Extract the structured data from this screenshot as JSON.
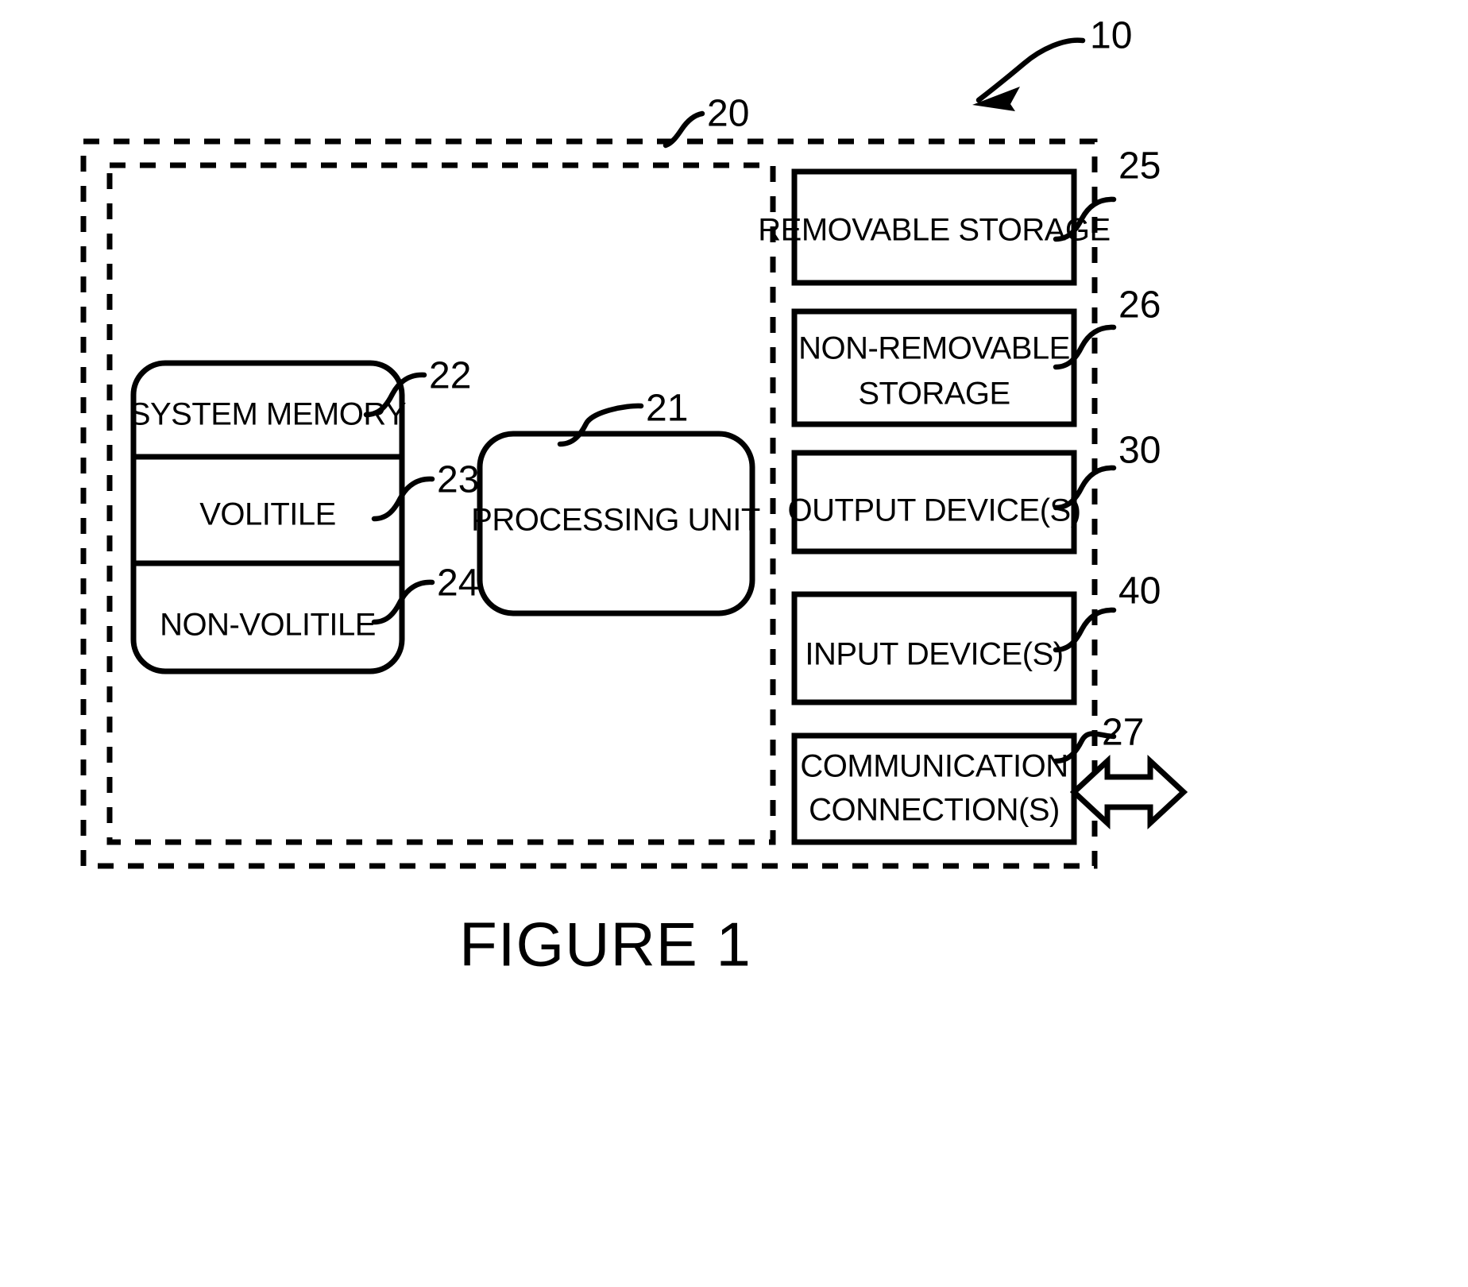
{
  "figure": {
    "caption": "FIGURE 1",
    "system_ref": "10",
    "device_ref": "20"
  },
  "inner_boxes": {
    "system_memory": {
      "label": "SYSTEM MEMORY",
      "ref": "22"
    },
    "volatile": {
      "label": "VOLITILE",
      "ref": "23"
    },
    "non_volatile": {
      "label": "NON-VOLITILE",
      "ref": "24"
    },
    "processing_unit": {
      "label": "PROCESSING UNIT",
      "ref": "21"
    }
  },
  "right_boxes": [
    {
      "label_line1": "REMOVABLE STORAGE",
      "label_line2": "",
      "ref": "25"
    },
    {
      "label_line1": "NON-REMOVABLE",
      "label_line2": "STORAGE",
      "ref": "26"
    },
    {
      "label_line1": "OUTPUT DEVICE(S)",
      "label_line2": "",
      "ref": "30"
    },
    {
      "label_line1": "INPUT DEVICE(S)",
      "label_line2": "",
      "ref": "40"
    },
    {
      "label_line1": "COMMUNICATION",
      "label_line2": "CONNECTION(S)",
      "ref": "27"
    }
  ],
  "colors": {
    "ink": "#000000",
    "paper": "#ffffff"
  }
}
